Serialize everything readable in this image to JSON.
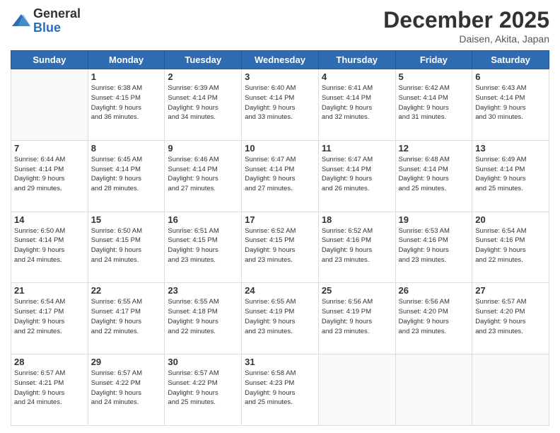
{
  "header": {
    "logo": {
      "general": "General",
      "blue": "Blue"
    },
    "title": "December 2025",
    "subtitle": "Daisen, Akita, Japan"
  },
  "calendar": {
    "weekdays": [
      "Sunday",
      "Monday",
      "Tuesday",
      "Wednesday",
      "Thursday",
      "Friday",
      "Saturday"
    ],
    "weeks": [
      [
        {
          "day": "",
          "info": ""
        },
        {
          "day": "1",
          "info": "Sunrise: 6:38 AM\nSunset: 4:15 PM\nDaylight: 9 hours\nand 36 minutes."
        },
        {
          "day": "2",
          "info": "Sunrise: 6:39 AM\nSunset: 4:14 PM\nDaylight: 9 hours\nand 34 minutes."
        },
        {
          "day": "3",
          "info": "Sunrise: 6:40 AM\nSunset: 4:14 PM\nDaylight: 9 hours\nand 33 minutes."
        },
        {
          "day": "4",
          "info": "Sunrise: 6:41 AM\nSunset: 4:14 PM\nDaylight: 9 hours\nand 32 minutes."
        },
        {
          "day": "5",
          "info": "Sunrise: 6:42 AM\nSunset: 4:14 PM\nDaylight: 9 hours\nand 31 minutes."
        },
        {
          "day": "6",
          "info": "Sunrise: 6:43 AM\nSunset: 4:14 PM\nDaylight: 9 hours\nand 30 minutes."
        }
      ],
      [
        {
          "day": "7",
          "info": "Sunrise: 6:44 AM\nSunset: 4:14 PM\nDaylight: 9 hours\nand 29 minutes."
        },
        {
          "day": "8",
          "info": "Sunrise: 6:45 AM\nSunset: 4:14 PM\nDaylight: 9 hours\nand 28 minutes."
        },
        {
          "day": "9",
          "info": "Sunrise: 6:46 AM\nSunset: 4:14 PM\nDaylight: 9 hours\nand 27 minutes."
        },
        {
          "day": "10",
          "info": "Sunrise: 6:47 AM\nSunset: 4:14 PM\nDaylight: 9 hours\nand 27 minutes."
        },
        {
          "day": "11",
          "info": "Sunrise: 6:47 AM\nSunset: 4:14 PM\nDaylight: 9 hours\nand 26 minutes."
        },
        {
          "day": "12",
          "info": "Sunrise: 6:48 AM\nSunset: 4:14 PM\nDaylight: 9 hours\nand 25 minutes."
        },
        {
          "day": "13",
          "info": "Sunrise: 6:49 AM\nSunset: 4:14 PM\nDaylight: 9 hours\nand 25 minutes."
        }
      ],
      [
        {
          "day": "14",
          "info": "Sunrise: 6:50 AM\nSunset: 4:14 PM\nDaylight: 9 hours\nand 24 minutes."
        },
        {
          "day": "15",
          "info": "Sunrise: 6:50 AM\nSunset: 4:15 PM\nDaylight: 9 hours\nand 24 minutes."
        },
        {
          "day": "16",
          "info": "Sunrise: 6:51 AM\nSunset: 4:15 PM\nDaylight: 9 hours\nand 23 minutes."
        },
        {
          "day": "17",
          "info": "Sunrise: 6:52 AM\nSunset: 4:15 PM\nDaylight: 9 hours\nand 23 minutes."
        },
        {
          "day": "18",
          "info": "Sunrise: 6:52 AM\nSunset: 4:16 PM\nDaylight: 9 hours\nand 23 minutes."
        },
        {
          "day": "19",
          "info": "Sunrise: 6:53 AM\nSunset: 4:16 PM\nDaylight: 9 hours\nand 23 minutes."
        },
        {
          "day": "20",
          "info": "Sunrise: 6:54 AM\nSunset: 4:16 PM\nDaylight: 9 hours\nand 22 minutes."
        }
      ],
      [
        {
          "day": "21",
          "info": "Sunrise: 6:54 AM\nSunset: 4:17 PM\nDaylight: 9 hours\nand 22 minutes."
        },
        {
          "day": "22",
          "info": "Sunrise: 6:55 AM\nSunset: 4:17 PM\nDaylight: 9 hours\nand 22 minutes."
        },
        {
          "day": "23",
          "info": "Sunrise: 6:55 AM\nSunset: 4:18 PM\nDaylight: 9 hours\nand 22 minutes."
        },
        {
          "day": "24",
          "info": "Sunrise: 6:55 AM\nSunset: 4:19 PM\nDaylight: 9 hours\nand 23 minutes."
        },
        {
          "day": "25",
          "info": "Sunrise: 6:56 AM\nSunset: 4:19 PM\nDaylight: 9 hours\nand 23 minutes."
        },
        {
          "day": "26",
          "info": "Sunrise: 6:56 AM\nSunset: 4:20 PM\nDaylight: 9 hours\nand 23 minutes."
        },
        {
          "day": "27",
          "info": "Sunrise: 6:57 AM\nSunset: 4:20 PM\nDaylight: 9 hours\nand 23 minutes."
        }
      ],
      [
        {
          "day": "28",
          "info": "Sunrise: 6:57 AM\nSunset: 4:21 PM\nDaylight: 9 hours\nand 24 minutes."
        },
        {
          "day": "29",
          "info": "Sunrise: 6:57 AM\nSunset: 4:22 PM\nDaylight: 9 hours\nand 24 minutes."
        },
        {
          "day": "30",
          "info": "Sunrise: 6:57 AM\nSunset: 4:22 PM\nDaylight: 9 hours\nand 25 minutes."
        },
        {
          "day": "31",
          "info": "Sunrise: 6:58 AM\nSunset: 4:23 PM\nDaylight: 9 hours\nand 25 minutes."
        },
        {
          "day": "",
          "info": ""
        },
        {
          "day": "",
          "info": ""
        },
        {
          "day": "",
          "info": ""
        }
      ]
    ]
  }
}
